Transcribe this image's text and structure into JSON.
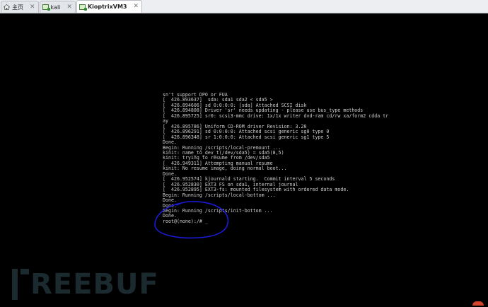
{
  "tabs": [
    {
      "label": "主页",
      "icon": "home-icon",
      "active": false
    },
    {
      "label": "kali",
      "icon": "vm-icon",
      "active": false
    },
    {
      "label": "KioptrixVM3",
      "icon": "vm-icon",
      "active": true
    }
  ],
  "close_glyph": "✕",
  "terminal": {
    "lines": [
      "sn't support DPO or FUA",
      "[  426.893637]  sda: sda1 sda2 < sda5 >",
      "[  426.894606] sd 0:0:0:0: [sda] Attached SCSI disk",
      "[  426.894808] Driver 'sr' needs updating - please use bus_type methods",
      "[  426.895725] sr0: scsi3-mmc drive: 1x/1x writer dvd-ram cd/rw xa/form2 cdda tr",
      "ay",
      "[  426.895786] Uniform CD-ROM driver Revision: 3.20",
      "[  426.896291] sd 0:0:0:0: Attached scsi generic sg0 type 0",
      "[  426.896348] sr 1:0:0:0: Attached scsi generic sg1 type 5",
      "Done.",
      "Begin: Running /scripts/local-premount ...",
      "kinit: name_to_dev_t(/dev/sda5) = sda5(8,5)",
      "kinit: trying to resume from /dev/sda5",
      "[  426.949311] Attempting manual resume",
      "kinit: No resume image, doing normal boot...",
      "Done.",
      "[  426.952574] kjournald starting.  Commit interval 5 seconds",
      "[  426.952830] EXT3 FS on sda1, internal journal",
      "[  426.952895] EXT3-fs: mounted filesystem with ordered data mode.",
      "Begin: Running /scripts/local-bottom ...",
      "Done.",
      "Done.",
      "Begin: Running /scripts/init-bottom ...",
      "Done.",
      "root@(none):/# "
    ],
    "cursor": "_"
  },
  "watermark": {
    "text": "REEBUF"
  },
  "colors": {
    "console_bg": "#000000",
    "console_text": "#cfcfcf",
    "annotation_stroke": "#1a1ad8",
    "watermark": "#1b2a2f",
    "tabbar_bg": "#eceef1"
  }
}
